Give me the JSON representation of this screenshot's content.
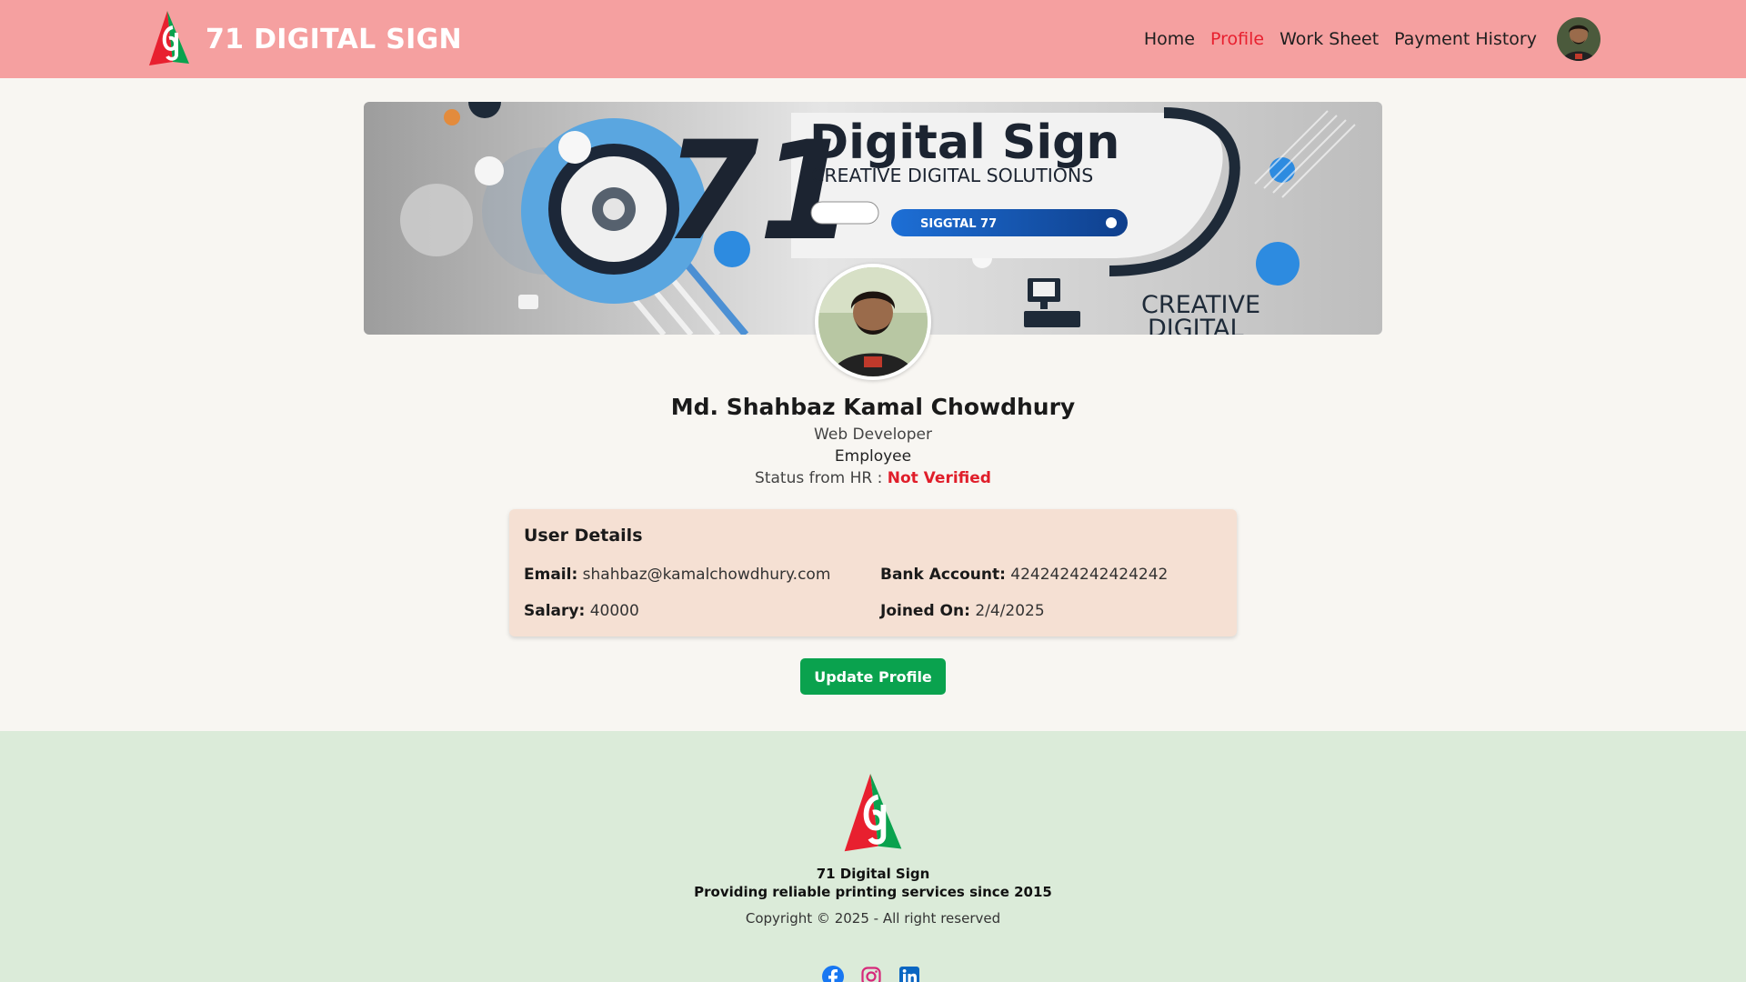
{
  "navbar": {
    "brand_name": "71 DIGITAL SIGN",
    "links": [
      {
        "label": "Home",
        "active": false
      },
      {
        "label": "Profile",
        "active": true
      },
      {
        "label": "Work Sheet",
        "active": false
      },
      {
        "label": "Payment History",
        "active": false
      }
    ],
    "avatar_icon": "user-avatar"
  },
  "banner": {
    "number": "71",
    "title": "Digital Sign",
    "subtitle": "CREATIVE DIGITAL SOLUTIONS",
    "pill_text": "SIGGTAL 77",
    "corner_line1": "CREATIVE",
    "corner_line2": "DIGITAL"
  },
  "profile": {
    "name": "Md. Shahbaz Kamal Chowdhury",
    "role": "Web Developer",
    "type": "Employee",
    "status_label": "Status from HR :",
    "status_value": "Not Verified"
  },
  "details": {
    "title": "User Details",
    "email_label": "Email:",
    "email": "shahbaz@kamalchowdhury.com",
    "bank_label": "Bank Account:",
    "bank": "4242424242424242",
    "salary_label": "Salary:",
    "salary": "40000",
    "joined_label": "Joined On:",
    "joined": "2/4/2025"
  },
  "update_button": "Update Profile",
  "footer": {
    "name": "71 Digital Sign",
    "tagline": "Providing reliable printing services since 2015",
    "copyright": "Copyright © 2025 - All right reserved",
    "socials": [
      "facebook-icon",
      "instagram-icon",
      "linkedin-icon"
    ]
  },
  "colors": {
    "navbar": "#f5a0a0",
    "active_link": "#e8202f",
    "status_red": "#e01e2a",
    "button_green": "#0aa24e",
    "card_bg": "#f5e0d3",
    "footer_bg": "#dbebd9"
  }
}
